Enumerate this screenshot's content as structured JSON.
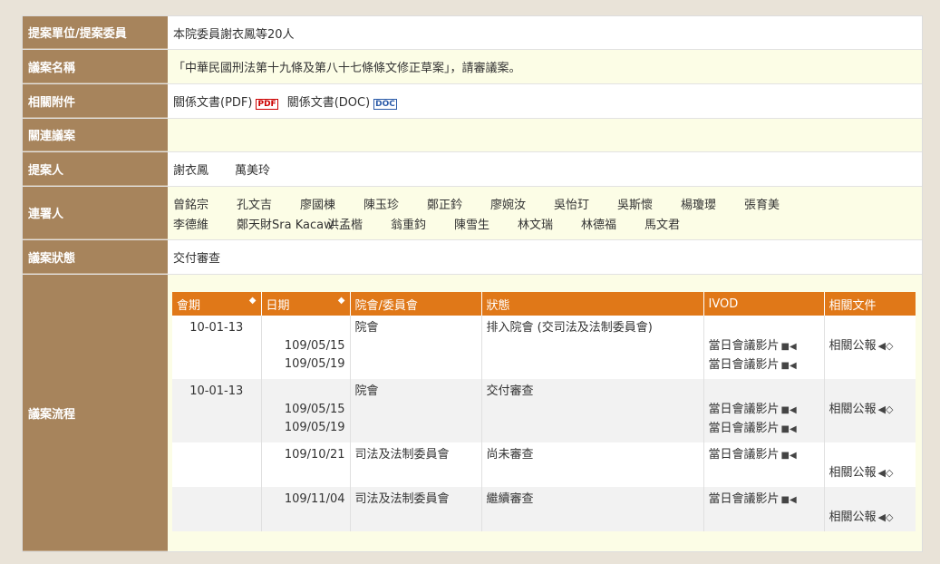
{
  "labels": {
    "proposer_unit": "提案單位/提案委員",
    "bill_name": "議案名稱",
    "attachments": "相關附件",
    "related_bills": "關連議案",
    "proposers": "提案人",
    "cosigners": "連署人",
    "status": "議案狀態",
    "process": "議案流程"
  },
  "values": {
    "proposer_unit": "本院委員謝衣鳳等20人",
    "bill_name": "「中華民國刑法第十九條及第八十七條條文修正草案」，請審議案。",
    "attach_pdf": "關係文書(PDF)",
    "attach_doc": "關係文書(DOC)",
    "pdf_icon": "PDF",
    "doc_icon": "DOC",
    "related_bills": "",
    "proposer_1": "謝衣鳳",
    "proposer_2": "萬美玲",
    "cosigners_line1": [
      "曾銘宗",
      "孔文吉",
      "廖國棟",
      "陳玉珍",
      "鄭正鈐",
      "廖婉汝",
      "吳怡玎",
      "吳斯懷",
      "楊瓊瓔",
      "張育美"
    ],
    "cosigners_line2": [
      "李德維",
      "鄭天財Sra Kacaw",
      "洪孟楷",
      "翁重鈞",
      "陳雪生",
      "林文瑞",
      "林德福",
      "馬文君"
    ],
    "status": "交付審查"
  },
  "table": {
    "headers": [
      "會期",
      "日期",
      "院會/委員會",
      "狀態",
      "IVOD",
      "相關文件"
    ],
    "sort_icon": "◆",
    "ivod_label": "當日會議影片",
    "doc_label": "相關公報",
    "rows": [
      {
        "session": "10-01-13",
        "date1": "109/05/15",
        "date2": "109/05/19",
        "body": "院會",
        "state": "排入院會 (交司法及法制委員會)"
      },
      {
        "session": "10-01-13",
        "date1": "109/05/15",
        "date2": "109/05/19",
        "body": "院會",
        "state": "交付審查"
      },
      {
        "session": "",
        "date1": "109/10/21",
        "body": "司法及法制委員會",
        "state": "尚未審查"
      },
      {
        "session": "",
        "date1": "109/11/04",
        "body": "司法及法制委員會",
        "state": "繼續審查"
      }
    ]
  }
}
